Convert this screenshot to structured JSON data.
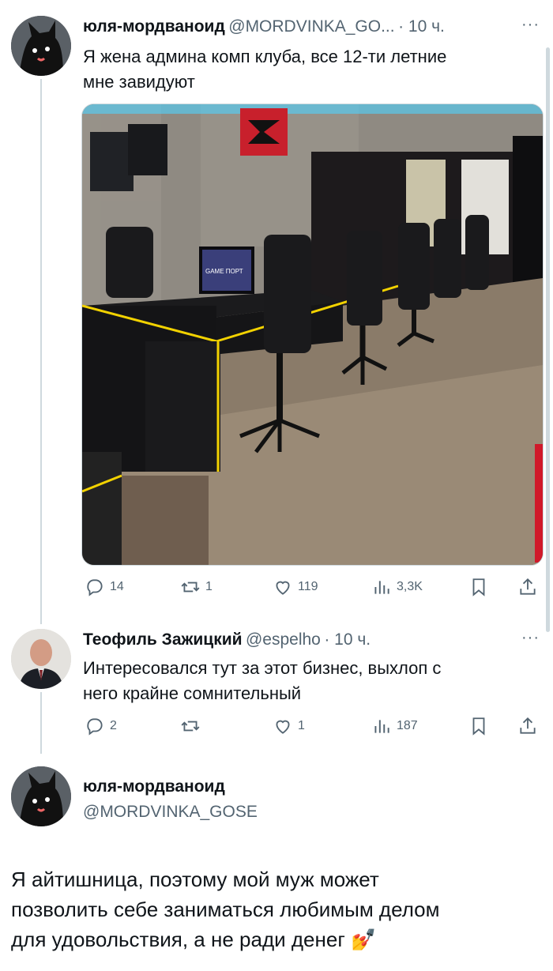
{
  "colors": {
    "text": "#0f1419",
    "muted": "#536471",
    "line": "#cfd9de",
    "chair": "#1a1a1c",
    "trim": "#f2d200"
  },
  "tweet1": {
    "name": "юля-мордваноид",
    "handle": "@MORDVINKA_GO...",
    "time": "· 10 ч.",
    "text_line1": "Я жена админа комп клуба, все 12-ти летние",
    "text_line2": "мне завидуют",
    "image_icon": "photo-gaming-club",
    "monitor_label": "GAME ПОРТ",
    "actions": {
      "replies": "14",
      "retweets": "1",
      "likes": "119",
      "views": "3,3K"
    }
  },
  "tweet2": {
    "name": "Теофиль Зажицкий",
    "handle": "@espelho",
    "time": "· 10 ч.",
    "text_line1": "Интересовался тут за этот бизнес, выхлоп с",
    "text_line2": "него крайне сомнительный",
    "actions": {
      "replies": "2",
      "retweets": "",
      "likes": "1",
      "views": "187"
    }
  },
  "tweet3": {
    "name": "юля-мордваноид",
    "handle": "@MORDVINKA_GOSE",
    "text_line1": "Я айтишница, поэтому мой муж может",
    "text_line2": "позволить себе заниматься любимым делом",
    "text_line3": "для удовольствия, а не ради денег",
    "emoji": "💅"
  },
  "icons": [
    "reply-icon",
    "retweet-icon",
    "like-icon",
    "views-icon",
    "bookmark-icon",
    "share-icon",
    "more-icon"
  ]
}
